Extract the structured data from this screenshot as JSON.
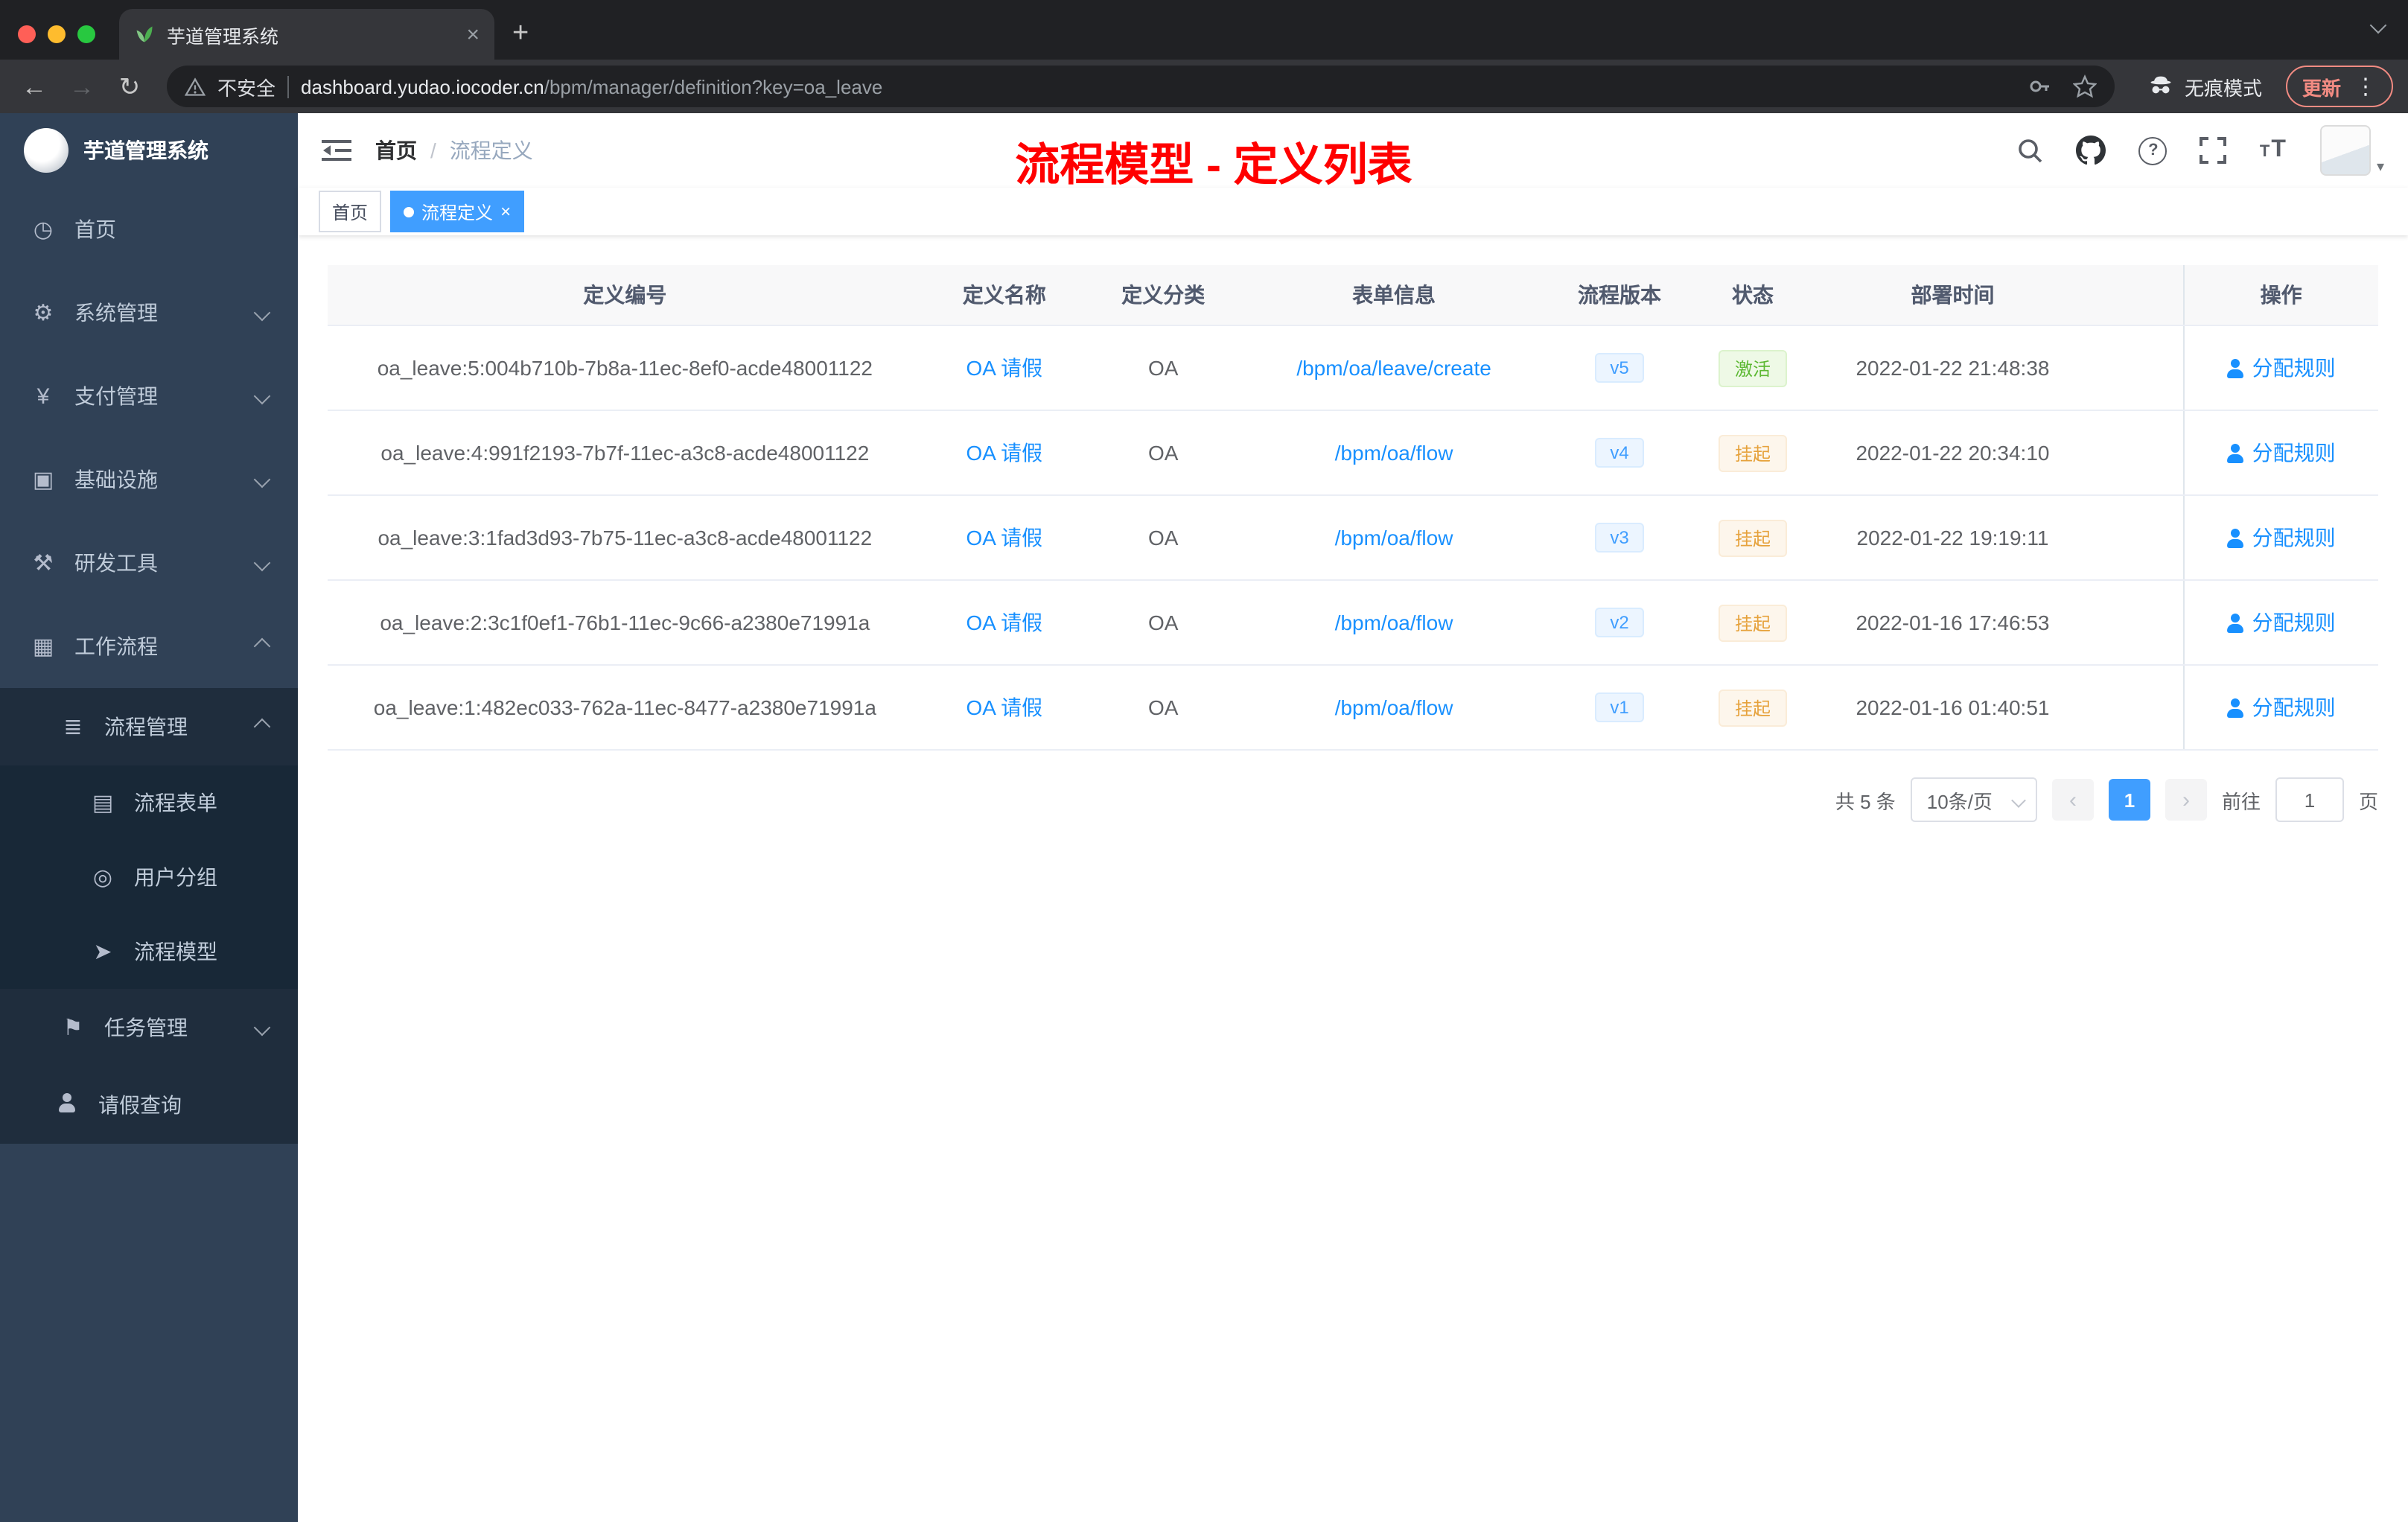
{
  "browser": {
    "tab_title": "芋道管理系统",
    "new_tab_label": "+",
    "security_label": "不安全",
    "url_host": "dashboard.yudao.iocoder.cn",
    "url_path": "/bpm/manager/definition?key=oa_leave",
    "incognito_label": "无痕模式",
    "update_label": "更新"
  },
  "annotation": {
    "text": "流程模型 - 定义列表",
    "color": "#ff0000"
  },
  "sidebar": {
    "logo_title": "芋道管理系统",
    "menu": [
      {
        "label": "首页",
        "icon": "dashboard-icon"
      },
      {
        "label": "系统管理",
        "icon": "gear-icon"
      },
      {
        "label": "支付管理",
        "icon": "yen-icon"
      },
      {
        "label": "基础设施",
        "icon": "infrastructure-icon"
      },
      {
        "label": "研发工具",
        "icon": "dev-tools-icon"
      },
      {
        "label": "工作流程",
        "icon": "workflow-icon"
      }
    ],
    "submenu": {
      "process_mgmt": {
        "label": "流程管理",
        "icon": "list-icon"
      },
      "children": [
        {
          "label": "流程表单",
          "icon": "form-icon"
        },
        {
          "label": "用户分组",
          "icon": "user-group-icon"
        },
        {
          "label": "流程模型",
          "icon": "model-icon"
        }
      ],
      "task_mgmt": {
        "label": "任务管理",
        "icon": "flag-icon"
      },
      "leave_query": {
        "label": "请假查询",
        "icon": "person-icon"
      }
    }
  },
  "header": {
    "breadcrumb": [
      "首页",
      "流程定义"
    ],
    "separator": "/",
    "icons": [
      "search-icon",
      "github-icon",
      "help-icon",
      "fullscreen-icon",
      "font-size-icon",
      "avatar"
    ]
  },
  "tags": [
    {
      "label": "首页"
    },
    {
      "label": "流程定义"
    }
  ],
  "table": {
    "headers": [
      "定义编号",
      "定义名称",
      "定义分类",
      "表单信息",
      "流程版本",
      "状态",
      "部署时间",
      "操作"
    ],
    "rows": [
      {
        "id": "oa_leave:5:004b710b-7b8a-11ec-8ef0-acde48001122",
        "name": "OA 请假",
        "category": "OA",
        "form": "/bpm/oa/leave/create",
        "version": "v5",
        "status": "激活",
        "status_type": "success",
        "deploy_time": "2022-01-22 21:48:38",
        "action": "分配规则"
      },
      {
        "id": "oa_leave:4:991f2193-7b7f-11ec-a3c8-acde48001122",
        "name": "OA 请假",
        "category": "OA",
        "form": "/bpm/oa/flow",
        "version": "v4",
        "status": "挂起",
        "status_type": "warning",
        "deploy_time": "2022-01-22 20:34:10",
        "action": "分配规则"
      },
      {
        "id": "oa_leave:3:1fad3d93-7b75-11ec-a3c8-acde48001122",
        "name": "OA 请假",
        "category": "OA",
        "form": "/bpm/oa/flow",
        "version": "v3",
        "status": "挂起",
        "status_type": "warning",
        "deploy_time": "2022-01-22 19:19:11",
        "action": "分配规则"
      },
      {
        "id": "oa_leave:2:3c1f0ef1-76b1-11ec-9c66-a2380e71991a",
        "name": "OA 请假",
        "category": "OA",
        "form": "/bpm/oa/flow",
        "version": "v2",
        "status": "挂起",
        "status_type": "warning",
        "deploy_time": "2022-01-16 17:46:53",
        "action": "分配规则"
      },
      {
        "id": "oa_leave:1:482ec033-762a-11ec-8477-a2380e71991a",
        "name": "OA 请假",
        "category": "OA",
        "form": "/bpm/oa/flow",
        "version": "v1",
        "status": "挂起",
        "status_type": "warning",
        "deploy_time": "2022-01-16 01:40:51",
        "action": "分配规则"
      }
    ]
  },
  "pagination": {
    "total": "共 5 条",
    "page_size": "10条/页",
    "prev": "‹",
    "current": "1",
    "next": "›",
    "goto_label": "前往",
    "goto_value": "1",
    "unit": "页"
  },
  "colors": {
    "accent_blue": "#1890ff",
    "success_green": "#5cb832",
    "warning_orange": "#e6a23c",
    "sidebar_bg": "#304156",
    "annotation_red": "#ff0000"
  }
}
